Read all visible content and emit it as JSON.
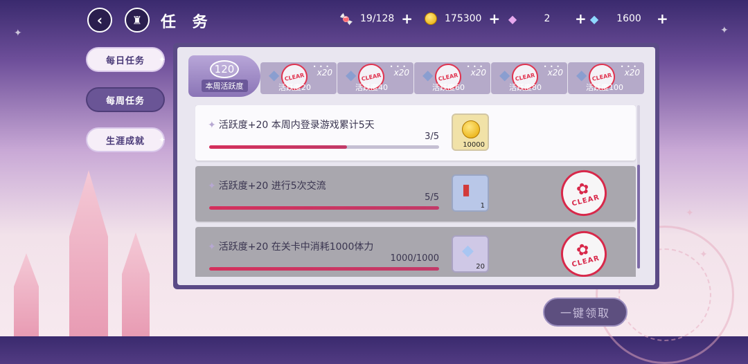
{
  "topbar": {
    "title": "任 务",
    "resources": [
      {
        "icon": "candy-icon",
        "glyph": "🍬",
        "value": "19/128"
      },
      {
        "icon": "coin-icon",
        "glyph": "",
        "value": "175300"
      },
      {
        "icon": "pink-gem-icon",
        "glyph": "◆",
        "value": "2"
      },
      {
        "icon": "blue-gem-icon",
        "glyph": "◆",
        "value": "1600"
      }
    ],
    "plus": "+"
  },
  "tabs": [
    {
      "label": "每日任务",
      "state": "light"
    },
    {
      "label": "每周任务",
      "state": "dark",
      "selected": true
    },
    {
      "label": "生涯成就",
      "state": "light"
    }
  ],
  "activity": {
    "points": "120",
    "label": "本周活跃度",
    "milestones": [
      {
        "threshold": "活跃度20",
        "count": "x20",
        "claimed": true
      },
      {
        "threshold": "活跃度40",
        "count": "x20",
        "claimed": true
      },
      {
        "threshold": "活跃度60",
        "count": "x20",
        "claimed": true
      },
      {
        "threshold": "活跃度80",
        "count": "x20",
        "claimed": true
      },
      {
        "threshold": "活跃度100",
        "count": "x20",
        "claimed": true
      }
    ]
  },
  "tasks": [
    {
      "desc": "活跃度+20 本周内登录游戏累计5天",
      "progress": "3/5",
      "fraction": 0.6,
      "reward_qty": "10000",
      "reward_icon": "coin-icon",
      "done": false
    },
    {
      "desc": "活跃度+20 进行5次交流",
      "progress": "5/5",
      "fraction": 1.0,
      "reward_qty": "1",
      "reward_icon": "canned-food-icon",
      "done": true
    },
    {
      "desc": "活跃度+20 在关卡中消耗1000体力",
      "progress": "1000/1000",
      "fraction": 1.0,
      "reward_qty": "20",
      "reward_icon": "diamond-icon",
      "done": true
    }
  ],
  "clear_text": "CLEAR",
  "claim_all": "一键领取"
}
